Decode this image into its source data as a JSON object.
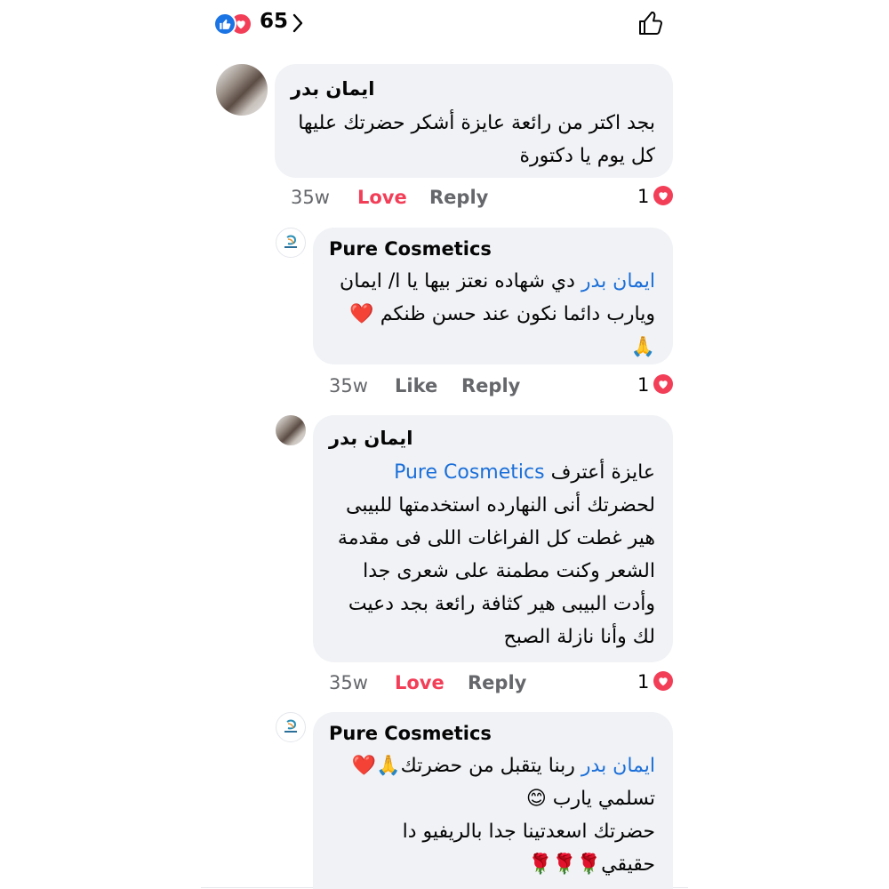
{
  "reactions": {
    "count": "65",
    "like_icon": "like-icon",
    "love_icon": "love-icon"
  },
  "comments": [
    {
      "author": "ايمان بدر",
      "lines": [
        "بجد اكتر من رائعة عايزة أشكر حضرتك عليها",
        "كل يوم يا دكتورة"
      ],
      "time": "35w",
      "reaction_label": "Love",
      "reply_label": "Reply",
      "reaction_count": "1"
    },
    {
      "author": "Pure Cosmetics",
      "mention": "ايمان بدر",
      "line1_rest": "دي شهاده نعتز بيها يا ا/ ايمان",
      "line2": "ويارب دائما نكون عند حسن ظنكم",
      "line2_emoji": "❤️",
      "line3": "🙏",
      "time": "35w",
      "reaction_label": "Like",
      "reply_label": "Reply",
      "reaction_count": "1"
    },
    {
      "author": "ايمان بدر",
      "mention": "Pure Cosmetics",
      "line1_rest": "عايزة أعترف",
      "lines": [
        "لحضرتك أنى النهارده استخدمتها للبيبى",
        "هير غطت كل الفراغات اللى فى مقدمة",
        "الشعر وكنت مطمنة على شعرى جدا",
        "وأدت البيبى هير كثافة رائعة بجد دعيت",
        "لك وأنا نازلة الصبح"
      ],
      "time": "35w",
      "reaction_label": "Love",
      "reply_label": "Reply",
      "reaction_count": "1"
    },
    {
      "author": "Pure Cosmetics",
      "mention": "ايمان بدر",
      "line1_rest": "ربنا يتقبل من حضرتك🙏❤️",
      "lines": [
        "تسلمي يارب 😊",
        "حضرتك اسعدتينا جدا بالريفيو دا",
        "حقيقي🌹🌹🌹"
      ]
    }
  ]
}
